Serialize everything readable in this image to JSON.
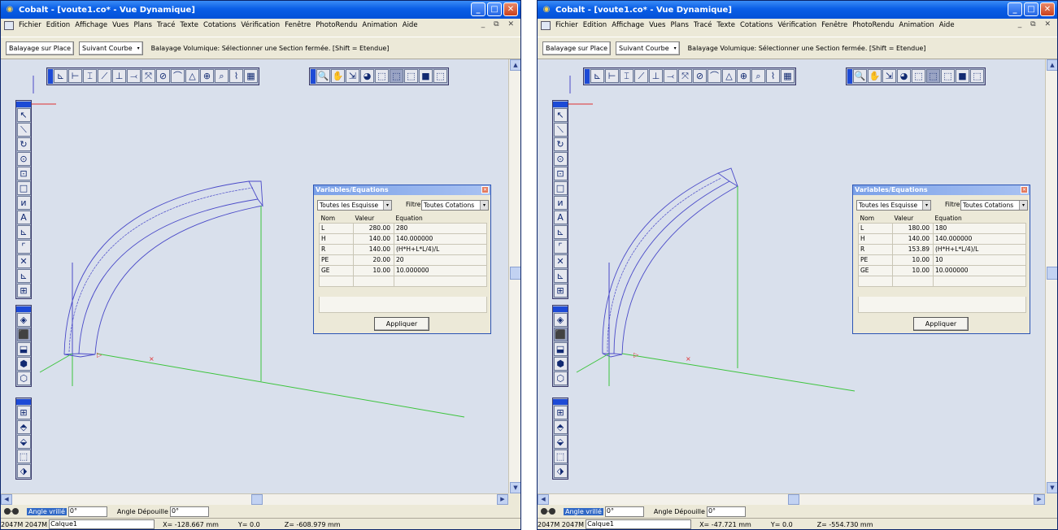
{
  "windows": [
    {
      "title": "Cobalt - [voute1.co* - Vue Dynamique]",
      "menu": [
        "Fichier",
        "Edition",
        "Affichage",
        "Vues",
        "Plans",
        "Tracé",
        "Texte",
        "Cotations",
        "Vérification",
        "Fenêtre",
        "PhotoRendu",
        "Animation",
        "Aide"
      ],
      "mdi_controls": "_ ⧉ ✕",
      "toolbar": {
        "btn_place": "Balayage sur Place",
        "btn_courbe": "Suivant Courbe",
        "prompt": "Balayage Volumique: Sélectionner une Section fermée. [Shift = Etendue]"
      },
      "dialog": {
        "title": "Variables/Equations",
        "filter1": "Toutes les Esquisse",
        "filter_label": "Filtre",
        "filter2": "Toutes Cotations",
        "columns": [
          "Nom",
          "Valeur",
          "Equation"
        ],
        "rows": [
          [
            "L",
            "280.00",
            "280"
          ],
          [
            "H",
            "140.00",
            "140.000000"
          ],
          [
            "R",
            "140.00",
            "(H*H+L*L/4)/L"
          ],
          [
            "PE",
            "20.00",
            "20"
          ],
          [
            "GE",
            "10.00",
            "10.000000"
          ]
        ],
        "apply": "Appliquer"
      },
      "status": {
        "angle_label": "Angle vrillé",
        "angle_value": "0°",
        "depouille_label": "Angle Dépouille",
        "depouille_value": "0°",
        "mem": "2047M 2047M",
        "calque": "Calque1",
        "x": "X= -128.667 mm",
        "y": "Y= 0.0",
        "z": "Z= -608.979 mm"
      }
    },
    {
      "title": "Cobalt - [voute1.co* - Vue Dynamique]",
      "menu": [
        "Fichier",
        "Edition",
        "Affichage",
        "Vues",
        "Plans",
        "Tracé",
        "Texte",
        "Cotations",
        "Vérification",
        "Fenêtre",
        "PhotoRendu",
        "Animation",
        "Aide"
      ],
      "mdi_controls": "_ ⧉ ✕",
      "toolbar": {
        "btn_place": "Balayage sur Place",
        "btn_courbe": "Suivant Courbe",
        "prompt": "Balayage Volumique: Sélectionner une Section fermée. [Shift = Etendue]"
      },
      "dialog": {
        "title": "Variables/Equations",
        "filter1": "Toutes les Esquisse",
        "filter_label": "Filtre",
        "filter2": "Toutes Cotations",
        "columns": [
          "Nom",
          "Valeur",
          "Equation"
        ],
        "rows": [
          [
            "L",
            "180.00",
            "180"
          ],
          [
            "H",
            "140.00",
            "140.000000"
          ],
          [
            "R",
            "153.89",
            "(H*H+L*L/4)/L"
          ],
          [
            "PE",
            "10.00",
            "10"
          ],
          [
            "GE",
            "10.00",
            "10.000000"
          ]
        ],
        "apply": "Appliquer"
      },
      "status": {
        "angle_label": "Angle vrillé",
        "angle_value": "0°",
        "depouille_label": "Angle Dépouille",
        "depouille_value": "0°",
        "mem": "2047M 2047M",
        "calque": "Calque1",
        "x": "X= -47.721 mm",
        "y": "Y= 0.0",
        "z": "Z= -554.730 mm"
      }
    }
  ],
  "glyphs": {
    "minimize": "_",
    "maximize": "□",
    "close": "✕",
    "dropdown": "▾",
    "arrow_up": "▲",
    "arrow_down": "▼",
    "arrow_left": "◀",
    "arrow_right": "▶"
  },
  "tools": {
    "draw_top": [
      "⊾",
      "⊢",
      "⌶",
      "⟋",
      "⊥",
      "⤙",
      "⤧",
      "⊘",
      "⌒",
      "△",
      "⊕",
      "⌕",
      "⌇",
      "▦"
    ],
    "view_top": [
      "🔍",
      "✋",
      "⇲",
      "◕",
      "⬚",
      "⬚",
      "⬚",
      "■",
      "⬚"
    ],
    "draw_left": [
      "↖",
      "⟍",
      "↻",
      "⊙",
      "⊡",
      "□",
      "ᴎ",
      "A",
      "⊾",
      "⌜",
      "✕",
      "⊾",
      "⊞"
    ],
    "solid_left": [
      "◈",
      "⬛",
      "⬓",
      "⬢",
      "⬡"
    ],
    "ops_left": [
      "⊞",
      "⬘",
      "⬙",
      "⬚",
      "⬗"
    ]
  },
  "colors": {
    "viewport": "#d9e0ec",
    "model": "#4a4ac8",
    "axes_green": "#3cc43c",
    "marker_red": "#e03030"
  }
}
